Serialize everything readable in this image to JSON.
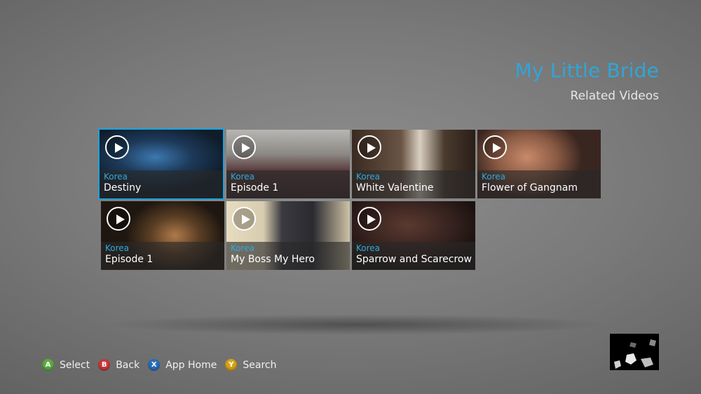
{
  "header": {
    "title": "My Little Bride",
    "subtitle": "Related Videos"
  },
  "tiles": [
    {
      "category": "Korea",
      "title": "Destiny",
      "selected": true
    },
    {
      "category": "Korea",
      "title": "Episode 1",
      "selected": false
    },
    {
      "category": "Korea",
      "title": "White Valentine",
      "selected": false
    },
    {
      "category": "Korea",
      "title": "Flower of Gangnam",
      "selected": false
    },
    {
      "category": "Korea",
      "title": "Episode 1",
      "selected": false
    },
    {
      "category": "Korea",
      "title": "My Boss My Hero",
      "selected": false
    },
    {
      "category": "Korea",
      "title": "Sparrow and Scarecrow",
      "selected": false
    }
  ],
  "controls": [
    {
      "key": "A",
      "label": "Select",
      "color": "#5aae3f"
    },
    {
      "key": "B",
      "label": "Back",
      "color": "#c8393a"
    },
    {
      "key": "X",
      "label": "App Home",
      "color": "#2a6fb8"
    },
    {
      "key": "Y",
      "label": "Search",
      "color": "#d9a418"
    }
  ],
  "colors": {
    "accent": "#2fa6d8",
    "selection": "#22a0d8"
  }
}
